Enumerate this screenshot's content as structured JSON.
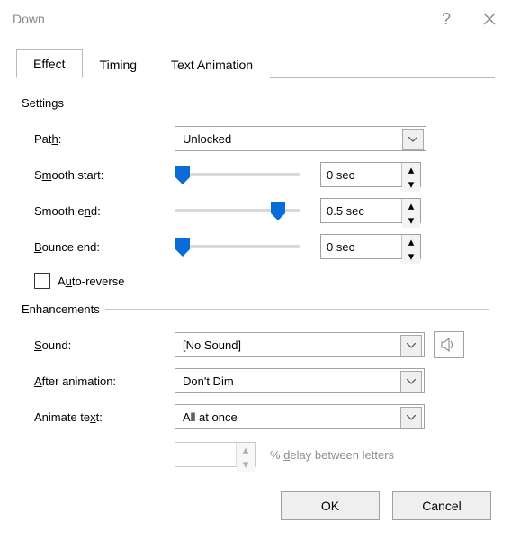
{
  "window": {
    "title": "Down"
  },
  "tabs": {
    "effect": "Effect",
    "timing": "Timing",
    "text_anim": "Text Animation",
    "active": "effect"
  },
  "groups": {
    "settings": "Settings",
    "enhancements": "Enhancements"
  },
  "settings": {
    "path_label_pre": "Pat",
    "path_label_u": "h",
    "path_label_post": ":",
    "path_value": "Unlocked",
    "smooth_start_pre": "S",
    "smooth_start_u": "m",
    "smooth_start_post": "ooth start:",
    "smooth_start_value": "0 sec",
    "smooth_end_pre": "Smooth e",
    "smooth_end_u": "n",
    "smooth_end_post": "d:",
    "smooth_end_value": "0.5 sec",
    "bounce_u": "B",
    "bounce_post": "ounce end:",
    "bounce_value": "0 sec",
    "auto_reverse_pre": "A",
    "auto_reverse_u": "u",
    "auto_reverse_post": "to-reverse"
  },
  "enhancements": {
    "sound_u": "S",
    "sound_post": "ound:",
    "sound_value": "[No Sound]",
    "after_u": "A",
    "after_post": "fter animation:",
    "after_value": "Don't Dim",
    "text_pre": "Animate te",
    "text_u": "x",
    "text_post": "t:",
    "text_value": "All at once",
    "delay_pre": "% ",
    "delay_u": "d",
    "delay_post": "elay between letters"
  },
  "footer": {
    "ok": "OK",
    "cancel": "Cancel"
  },
  "colors": {
    "accent": "#1e90ff"
  }
}
